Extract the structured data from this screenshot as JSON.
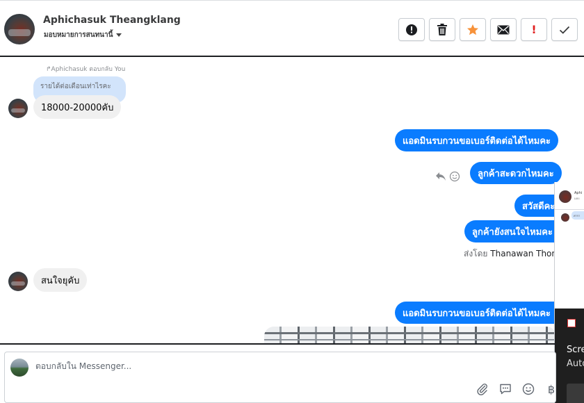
{
  "header": {
    "name": "Aphichasuk Theangklang",
    "assign_label": "มอบหมายการสนทนานี้",
    "actions": [
      {
        "icon": "alert-circle-icon",
        "label": ""
      },
      {
        "icon": "trash-icon",
        "label": ""
      },
      {
        "icon": "star-icon",
        "label": ""
      },
      {
        "icon": "envelope-icon",
        "label": ""
      },
      {
        "icon": "exclamation-icon",
        "label": "!"
      },
      {
        "icon": "check-icon",
        "label": ""
      }
    ]
  },
  "conversation": {
    "reply_caption": "Aphichasuk ตอบกลับ You",
    "quoted_text": "รายได้ต่อเดือนเท่าไรคะ",
    "messages": [
      {
        "from": "customer",
        "text": "18000-20000คับ"
      },
      {
        "from": "page",
        "text": "แอดมินรบกวนขอเบอร์ติดต่อได้ไหมคะ"
      },
      {
        "from": "page",
        "text": "ลูกค้าสะดวกไหมคะ"
      },
      {
        "from": "page",
        "text": "สวัสดีคะ"
      },
      {
        "from": "page",
        "text": "ลูกค้ายังสนใจไหมคะ"
      },
      {
        "from": "customer",
        "text": "สนใจยุคับ"
      },
      {
        "from": "page",
        "text": "แอดมินรบกวนขอเบอร์ติดต่อได้ไหมคะ"
      }
    ],
    "sent_by_prefix": "ส่งโดย",
    "sent_by_name": "Thanawan Thon"
  },
  "overlay": {
    "mini_name": "Aphi",
    "mini_sub": "มอบ",
    "mini_bubble": "ค่ารา",
    "text_line1": "Scre",
    "text_line2": "Auto"
  },
  "composer": {
    "placeholder": "ตอบกลับใน Messenger...",
    "value": "",
    "tools": [
      "paperclip-icon",
      "chat-bubble-icon",
      "emoji-icon",
      "baht-icon"
    ],
    "baht_symbol": "฿"
  },
  "colors": {
    "outgoing_bubble": "#0a7cff",
    "incoming_bubble": "#f0f0f0",
    "quoted_bubble": "#d2e4fb",
    "star": "#f7923a",
    "alert_red": "#e02020"
  }
}
